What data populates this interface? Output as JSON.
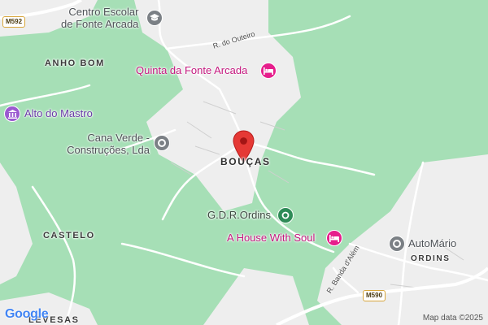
{
  "map": {
    "place_labels": {
      "boucas": "BOUÇAS",
      "anho_bom": "ANHO BOM",
      "castelo": "CASTELO",
      "levesas": "LEVESAS",
      "ordins": "ORDINS"
    },
    "pois": {
      "centro_escolar": {
        "line1": "Centro Escolar",
        "line2": "de Fonte Arcada",
        "icon": "school-icon"
      },
      "quinta": {
        "label": "Quinta da Fonte Arcada",
        "icon": "hotel-icon"
      },
      "alto_do_mastro": {
        "label": "Alto do Mastro",
        "icon": "landmark-icon"
      },
      "cana_verde": {
        "line1": "Cana Verde -",
        "line2": "Construções, Lda",
        "icon": "place-icon"
      },
      "gdr_ordins": {
        "label": "G.D.R.Ordins",
        "icon": "sports-icon"
      },
      "house_with_soul": {
        "label": "A House With Soul",
        "icon": "hotel-icon"
      },
      "automario": {
        "label": "AutoMário",
        "icon": "place-icon"
      }
    },
    "streets": {
      "r_do_outeiro": "R. do Outeiro",
      "r_banda_dalem": "R. Banda d'Além"
    },
    "road_shields": {
      "m592": "M592",
      "m590": "M590"
    },
    "marker": {
      "icon": "location-pin-icon"
    },
    "attribution": "Map data ©2025",
    "logo": "Google",
    "colors": {
      "green": "#a6dfb6",
      "urban": "#eeeeee",
      "road": "#ffffff",
      "pin": "#e53935",
      "poi_pink": "#e61e8c",
      "poi_gray": "#7b8085",
      "poi_green": "#2e8b57",
      "poi_purple": "#9b59d0"
    }
  }
}
